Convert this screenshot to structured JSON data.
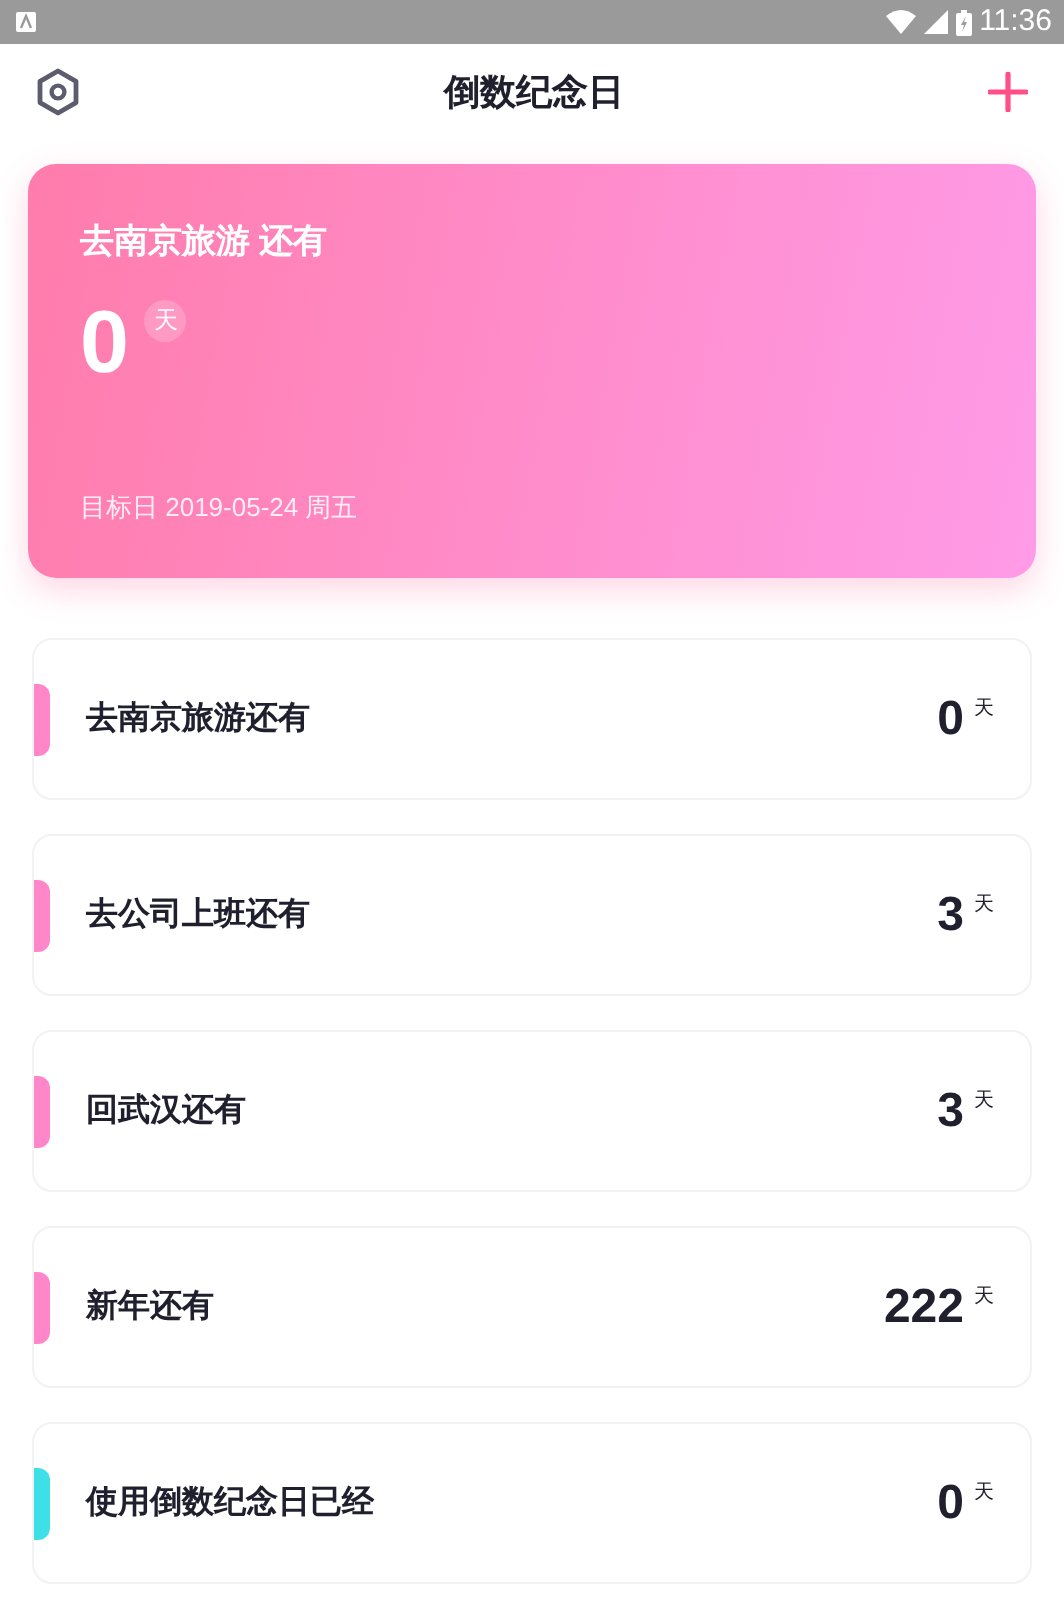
{
  "status_bar": {
    "time": "11:36"
  },
  "header": {
    "title": "倒数纪念日"
  },
  "hero": {
    "title": "去南京旅游 还有",
    "days": "0",
    "unit": "天",
    "target": "目标日 2019-05-24 周五"
  },
  "events": [
    {
      "name": "去南京旅游还有",
      "days": "0",
      "unit": "天",
      "color": "#ff86c8"
    },
    {
      "name": "去公司上班还有",
      "days": "3",
      "unit": "天",
      "color": "#ff86c8"
    },
    {
      "name": "回武汉还有",
      "days": "3",
      "unit": "天",
      "color": "#ff86c8"
    },
    {
      "name": "新年还有",
      "days": "222",
      "unit": "天",
      "color": "#ff86c8"
    },
    {
      "name": "使用倒数纪念日已经",
      "days": "0",
      "unit": "天",
      "color": "#3ee0e8"
    }
  ]
}
